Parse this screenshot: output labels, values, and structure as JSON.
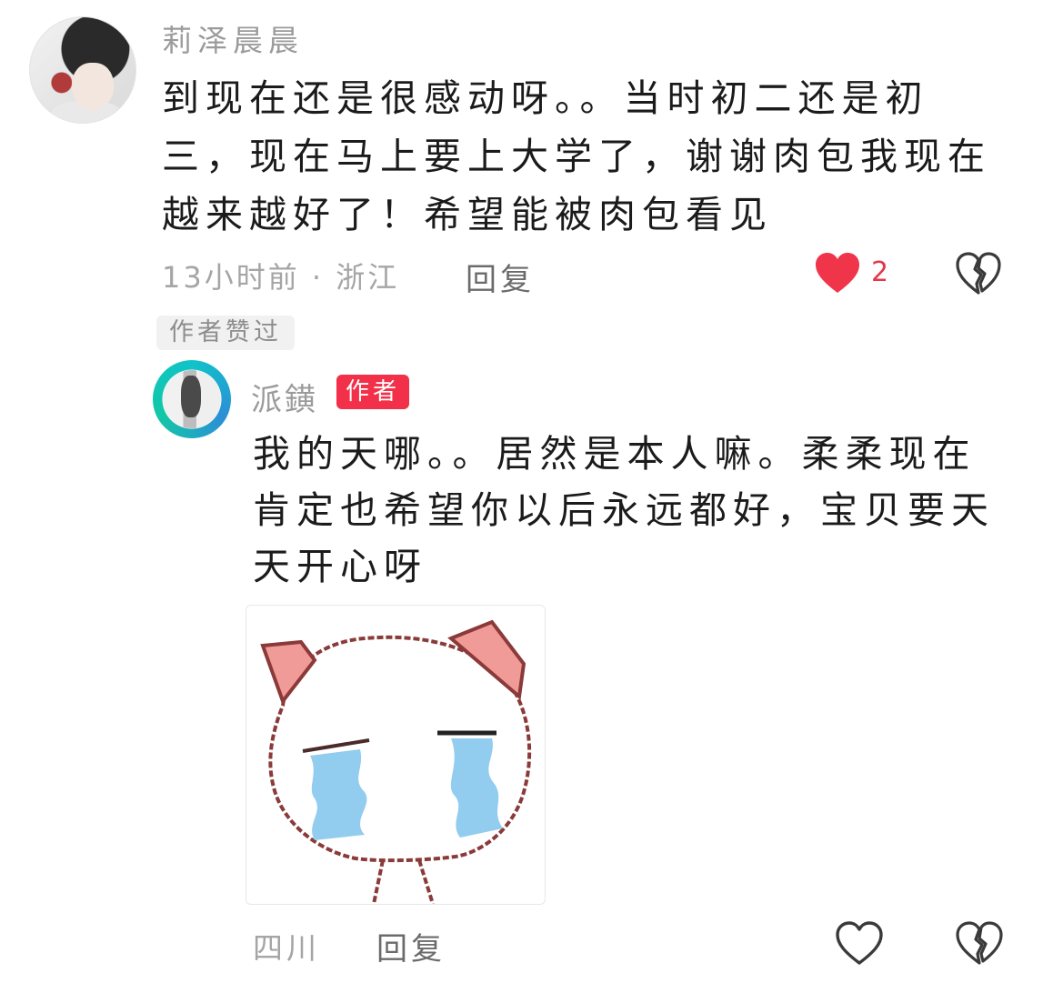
{
  "comment": {
    "username": "莉泽晨晨",
    "text": "到现在还是很感动呀。。当时初二还是初\n三，现在马上要上大学了，谢谢肉包我现在\n越来越好了！希望能被肉包看见",
    "time_location": "13小时前 · 浙江",
    "reply_label": "回复",
    "like_count": "2",
    "liked": true,
    "like_color": "#f0344a",
    "author_liked_label": "作者赞过"
  },
  "reply": {
    "username": "派鐄",
    "author_badge": "作者",
    "text": "我的天哪。。居然是本人嘛。柔柔现在\n肯定也希望你以后永远都好，宝贝要天\n天开心呀",
    "sticker": "crying-cat-sticker",
    "location": "四川",
    "reply_label": "回复",
    "liked": false
  },
  "icons": {
    "like": "heart-icon",
    "dislike": "broken-heart-icon"
  },
  "colors": {
    "accent_red": "#f2304a",
    "text_primary": "#1b1b1b",
    "text_secondary": "#a5a5a5",
    "avatar_ring": "#0fc4c8"
  }
}
